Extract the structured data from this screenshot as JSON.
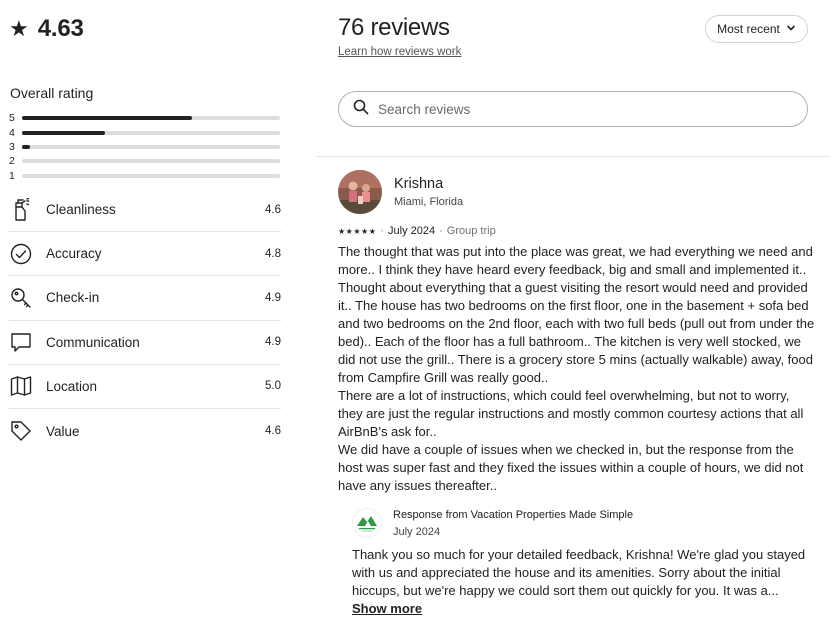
{
  "summary": {
    "average": "4.63",
    "overall_title": "Overall rating",
    "distribution": [
      {
        "stars": "5",
        "fraction": 0.66
      },
      {
        "stars": "4",
        "fraction": 0.32
      },
      {
        "stars": "3",
        "fraction": 0.03
      },
      {
        "stars": "2",
        "fraction": 0.0
      },
      {
        "stars": "1",
        "fraction": 0.0
      }
    ],
    "categories": [
      {
        "name": "Cleanliness",
        "score": "4.6",
        "icon": "spray-bottle-icon"
      },
      {
        "name": "Accuracy",
        "score": "4.8",
        "icon": "check-circle-icon"
      },
      {
        "name": "Check-in",
        "score": "4.9",
        "icon": "key-icon"
      },
      {
        "name": "Communication",
        "score": "4.9",
        "icon": "chat-bubble-icon"
      },
      {
        "name": "Location",
        "score": "5.0",
        "icon": "map-icon"
      },
      {
        "name": "Value",
        "score": "4.6",
        "icon": "tag-icon"
      }
    ]
  },
  "reviews_header": {
    "title": "76 reviews",
    "link": "Learn how reviews work",
    "sort_label": "Most recent",
    "search_placeholder": "Search reviews"
  },
  "review": {
    "name": "Krishna",
    "location": "Miami, Florida",
    "stars": "★★★★★",
    "date": "July 2024",
    "separator": "·",
    "trip_type": "Group trip",
    "text": "The thought that was put into the place was great, we had everything we need and more.. I think they have heard every feedback, big and small and implemented it.. Thought about everything that a guest visiting the resort would need and provided it.. The house has two bedrooms on the first floor, one in the basement + sofa bed and two bedrooms on the 2nd floor, each with two full beds (pull out from under the bed).. Each of the floor has a full bathroom.. The kitchen is very well stocked, we did not use the grill.. There is a grocery store 5 mins (actually walkable) away, food from Campfire Grill was really good..\nThere are a lot of instructions, which could feel overwhelming, but not to worry, they are just the regular instructions and mostly common courtesy actions that all AirBnB's ask for..\nWe did have a couple of issues when we checked in, but the response from the host was super fast and they fixed the issues within a couple of hours, we did not have any issues thereafter..",
    "response": {
      "title": "Response from Vacation Properties Made Simple",
      "date": "July 2024",
      "text": "Thank you so much for your detailed feedback, Krishna! We're glad you stayed with us and appreciated the house and its amenities. Sorry about the initial hiccups, but we're happy we could sort them out quickly for you. It was a...",
      "show_more": "Show more"
    }
  },
  "colors": {
    "text": "#222222",
    "muted": "#717171",
    "bar_track": "#dddddd",
    "divider": "#e4e4e4",
    "host_logo_green": "#2e9a3e"
  }
}
